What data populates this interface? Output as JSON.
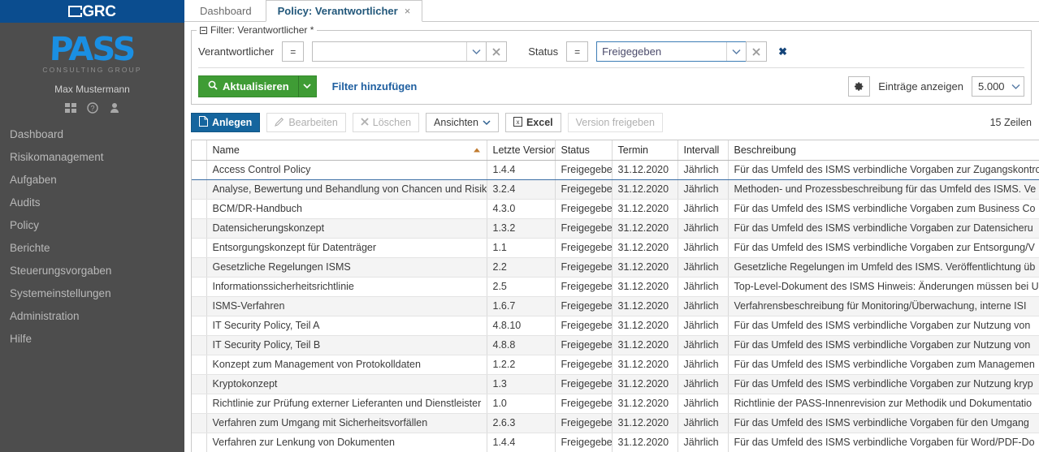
{
  "brand": {
    "logo_text": "GRC",
    "logo_mark": "bracket-a-mark"
  },
  "sidebar": {
    "company_logo": "PASS",
    "company_sub": "CONSULTING GROUP",
    "user_name": "Max Mustermann",
    "icons": [
      {
        "name": "apps-grid-icon",
        "label": "Apps"
      },
      {
        "name": "help-icon",
        "label": "Hilfe"
      },
      {
        "name": "user-icon",
        "label": "Benutzer"
      }
    ],
    "items": [
      {
        "label": "Dashboard"
      },
      {
        "label": "Risikomanagement"
      },
      {
        "label": "Aufgaben"
      },
      {
        "label": "Audits"
      },
      {
        "label": "Policy"
      },
      {
        "label": "Berichte"
      },
      {
        "label": "Steuerungsvorgaben"
      },
      {
        "label": "Systemeinstellungen"
      },
      {
        "label": "Administration"
      },
      {
        "label": "Hilfe"
      }
    ]
  },
  "tabs": [
    {
      "label": "Dashboard",
      "active": false,
      "closable": false
    },
    {
      "label": "Policy: Verantwortlicher",
      "active": true,
      "closable": true,
      "close_glyph": "×"
    }
  ],
  "filter": {
    "legend": "Filter: Verantwortlicher *",
    "criteria": [
      {
        "label": "Verantwortlicher",
        "operator": "=",
        "value": "",
        "placeholder": "",
        "focused": false,
        "dropdown_icon": "chevron-down-icon",
        "clear_icon": "clear-icon"
      },
      {
        "label": "Status",
        "operator": "=",
        "value": "Freigegeben",
        "placeholder": "",
        "focused": true,
        "dropdown_icon": "chevron-down-icon",
        "clear_icon": "clear-icon"
      }
    ],
    "remove_filter_glyph": "✖",
    "refresh_label": "Aktualisieren",
    "refresh_icon": "search-icon",
    "refresh_split_glyph": "⌄",
    "add_filter_label": "Filter hinzufügen",
    "settings_icon": "gear-icon",
    "entries_label": "Einträge anzeigen",
    "entries_value": "5.000"
  },
  "toolbar": {
    "create_label": "Anlegen",
    "create_icon": "document-icon",
    "edit_label": "Bearbeiten",
    "edit_icon": "pencil-icon",
    "delete_label": "Löschen",
    "delete_icon": "cross-icon",
    "views_label": "Ansichten",
    "views_icon": "chevron-down-icon",
    "excel_label": "Excel",
    "excel_icon": "excel-icon",
    "release_label": "Version freigeben",
    "row_count": "15 Zeilen"
  },
  "table": {
    "columns": [
      {
        "key": "name",
        "label": "Name",
        "sorted": "asc"
      },
      {
        "key": "version",
        "label": "Letzte Version"
      },
      {
        "key": "status",
        "label": "Status"
      },
      {
        "key": "termin",
        "label": "Termin"
      },
      {
        "key": "intervall",
        "label": "Intervall"
      },
      {
        "key": "beschreibung",
        "label": "Beschreibung"
      }
    ],
    "rows": [
      {
        "name": "Access Control Policy",
        "version": "1.4.4",
        "status": "Freigegeben",
        "termin": "31.12.2020",
        "intervall": "Jährlich",
        "beschreibung": "Für das Umfeld des ISMS verbindliche Vorgaben zur Zugangskontrolle"
      },
      {
        "name": "Analyse, Bewertung und Behandlung von Chancen und Risiken",
        "version": "3.2.4",
        "status": "Freigegeben",
        "termin": "31.12.2020",
        "intervall": "Jährlich",
        "beschreibung": "Methoden- und Prozessbeschreibung für das Umfeld des ISMS. Ve"
      },
      {
        "name": "BCM/DR-Handbuch",
        "version": "4.3.0",
        "status": "Freigegeben",
        "termin": "31.12.2020",
        "intervall": "Jährlich",
        "beschreibung": "Für das Umfeld des ISMS verbindliche Vorgaben zum Business Co"
      },
      {
        "name": "Datensicherungskonzept",
        "version": "1.3.2",
        "status": "Freigegeben",
        "termin": "31.12.2020",
        "intervall": "Jährlich",
        "beschreibung": "Für das Umfeld des ISMS verbindliche Vorgaben zur Datensicheru"
      },
      {
        "name": "Entsorgungskonzept für Datenträger",
        "version": "1.1",
        "status": "Freigegeben",
        "termin": "31.12.2020",
        "intervall": "Jährlich",
        "beschreibung": "Für das Umfeld des ISMS verbindliche Vorgaben zur Entsorgung/V"
      },
      {
        "name": "Gesetzliche Regelungen ISMS",
        "version": "2.2",
        "status": "Freigegeben",
        "termin": "31.12.2020",
        "intervall": "Jährlich",
        "beschreibung": "Gesetzliche Regelungen im Umfeld des ISMS. Veröffentlichtung üb"
      },
      {
        "name": "Informationssicherheitsrichtlinie",
        "version": "2.5",
        "status": "Freigegeben",
        "termin": "31.12.2020",
        "intervall": "Jährlich",
        "beschreibung": "Top-Level-Dokument des ISMS Hinweis: Änderungen müssen bei U"
      },
      {
        "name": "ISMS-Verfahren",
        "version": "1.6.7",
        "status": "Freigegeben",
        "termin": "31.12.2020",
        "intervall": "Jährlich",
        "beschreibung": "Verfahrensbeschreibung für Monitoring/Überwachung, interne ISI"
      },
      {
        "name": "IT Security Policy, Teil A",
        "version": "4.8.10",
        "status": "Freigegeben",
        "termin": "31.12.2020",
        "intervall": "Jährlich",
        "beschreibung": "Für das Umfeld des ISMS verbindliche Vorgaben zur Nutzung von"
      },
      {
        "name": "IT Security Policy, Teil B",
        "version": "4.8.8",
        "status": "Freigegeben",
        "termin": "31.12.2020",
        "intervall": "Jährlich",
        "beschreibung": "Für das Umfeld des ISMS verbindliche Vorgaben zur Nutzung von"
      },
      {
        "name": "Konzept zum Management von Protokolldaten",
        "version": "1.2.2",
        "status": "Freigegeben",
        "termin": "31.12.2020",
        "intervall": "Jährlich",
        "beschreibung": "Für das Umfeld des ISMS verbindliche Vorgaben zum Managemen"
      },
      {
        "name": "Kryptokonzept",
        "version": "1.3",
        "status": "Freigegeben",
        "termin": "31.12.2020",
        "intervall": "Jährlich",
        "beschreibung": "Für das Umfeld des ISMS verbindliche Vorgaben zur Nutzung kryp"
      },
      {
        "name": "Richtlinie zur Prüfung externer Lieferanten und Dienstleister",
        "version": "1.0",
        "status": "Freigegeben",
        "termin": "31.12.2020",
        "intervall": "Jährlich",
        "beschreibung": "Richtlinie der PASS-Innenrevision zur Methodik und Dokumentatio"
      },
      {
        "name": "Verfahren zum Umgang mit Sicherheitsvorfällen",
        "version": "2.6.3",
        "status": "Freigegeben",
        "termin": "31.12.2020",
        "intervall": "Jährlich",
        "beschreibung": "Für das Umfeld des ISMS verbindliche Vorgaben für den Umgang"
      },
      {
        "name": "Verfahren zur Lenkung von Dokumenten",
        "version": "1.4.4",
        "status": "Freigegeben",
        "termin": "31.12.2020",
        "intervall": "Jährlich",
        "beschreibung": "Für das Umfeld des ISMS verbindliche Vorgaben für Word/PDF-Do"
      }
    ]
  },
  "colors": {
    "brand_blue": "#0b4d8f",
    "sidebar_bg": "#4d4d4d",
    "accent_blue": "#1a8fe3",
    "primary_button": "#15659e",
    "refresh_green": "#3f9c35",
    "link_blue": "#1f5fa0"
  }
}
